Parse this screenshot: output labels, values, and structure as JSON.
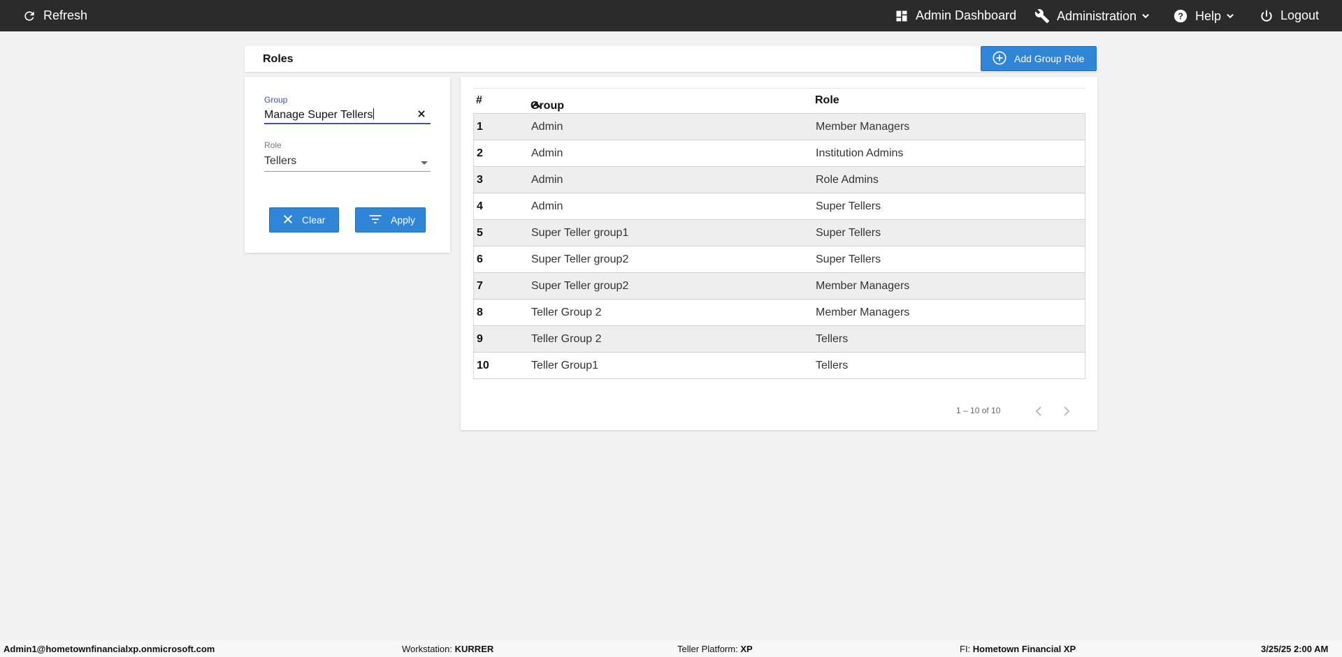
{
  "topbar": {
    "refresh_label": "Refresh",
    "admin_dashboard_label": "Admin Dashboard",
    "administration_label": "Administration",
    "help_label": "Help",
    "logout_label": "Logout"
  },
  "page": {
    "title": "Roles",
    "add_button_label": "Add Group Role"
  },
  "filters": {
    "group_label": "Group",
    "group_value": "Manage Super Tellers",
    "role_label": "Role",
    "role_value": "Tellers",
    "clear_label": "Clear",
    "apply_label": "Apply"
  },
  "table": {
    "columns": [
      "#",
      "Group",
      "Role"
    ],
    "sort_column": "Group",
    "rows": [
      {
        "num": "1",
        "group": "Admin",
        "role": "Member Managers"
      },
      {
        "num": "2",
        "group": "Admin",
        "role": "Institution Admins"
      },
      {
        "num": "3",
        "group": "Admin",
        "role": "Role Admins"
      },
      {
        "num": "4",
        "group": "Admin",
        "role": "Super Tellers"
      },
      {
        "num": "5",
        "group": "Super Teller group1",
        "role": "Super Tellers"
      },
      {
        "num": "6",
        "group": "Super Teller group2",
        "role": "Super Tellers"
      },
      {
        "num": "7",
        "group": "Super Teller group2",
        "role": "Member Managers"
      },
      {
        "num": "8",
        "group": "Teller Group 2",
        "role": "Member Managers"
      },
      {
        "num": "9",
        "group": "Teller Group 2",
        "role": "Tellers"
      },
      {
        "num": "10",
        "group": "Teller Group1",
        "role": "Tellers"
      }
    ],
    "pagination_text": "1 – 10 of 10"
  },
  "footer": {
    "user": "Admin1@hometownfinancialxp.onmicrosoft.com",
    "workstation_label": "Workstation:",
    "workstation_value": "KURRER",
    "teller_platform_label": "Teller Platform:",
    "teller_platform_value": "XP",
    "fi_label": "FI:",
    "fi_value": "Hometown Financial XP",
    "datetime": "3/25/25 2:00 AM"
  },
  "colors": {
    "topbar_bg": "#2b2b2b",
    "accent_blue": "#2f86d8",
    "input_focus": "#3f51b5",
    "page_bg": "#f2f2f2"
  },
  "icons": {
    "refresh": "refresh-icon",
    "dashboard": "dashboard-icon",
    "administration": "wrench-icon",
    "help": "help-circle-icon",
    "logout": "power-icon",
    "add": "plus-circle-icon",
    "clear": "close-icon",
    "apply": "filter-icon",
    "sort": "sort-asc-icon"
  }
}
